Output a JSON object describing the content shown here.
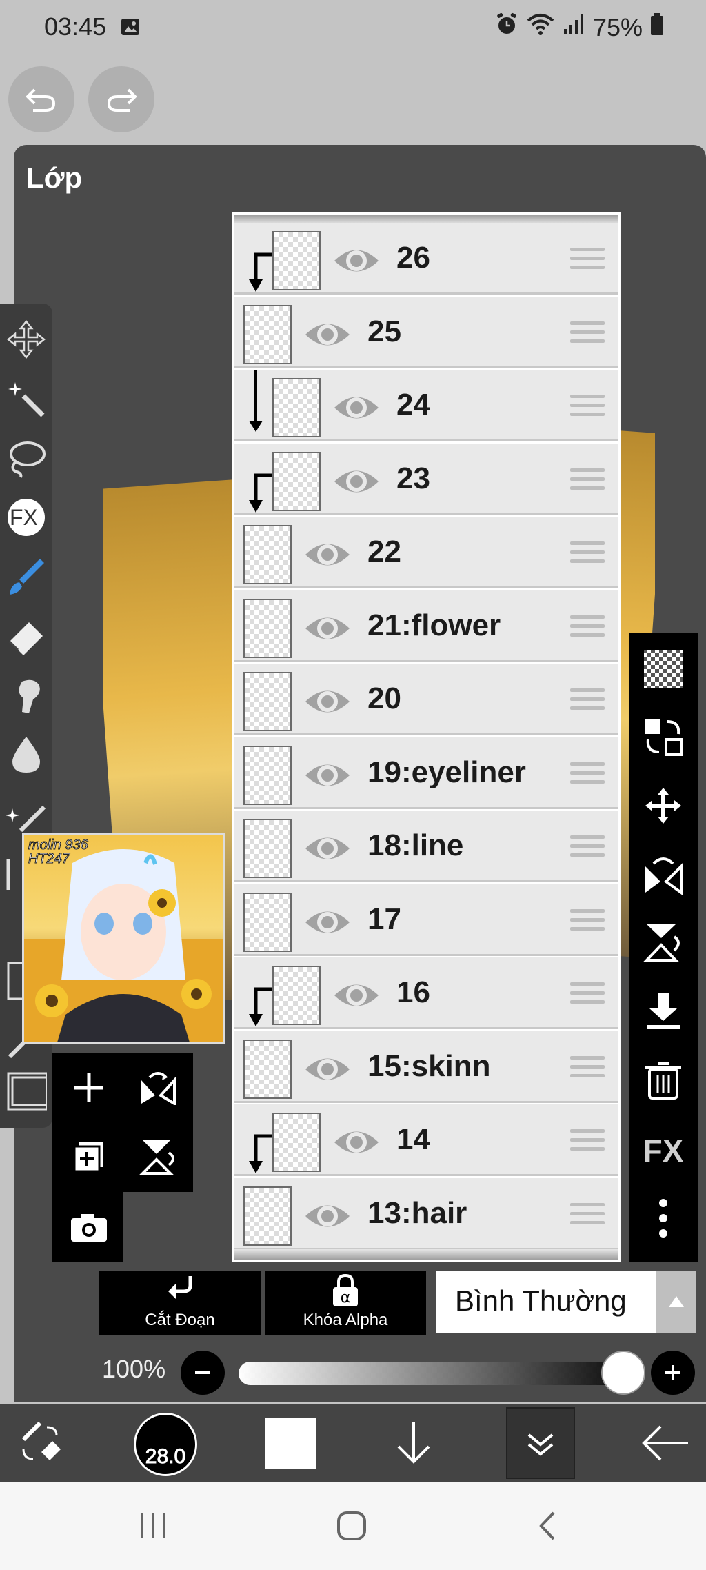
{
  "status_bar": {
    "time": "03:45",
    "battery": "75%",
    "icons": [
      "gallery-icon",
      "alarm-icon",
      "wifi-icon",
      "signal-icon",
      "battery-icon"
    ]
  },
  "panel": {
    "title": "Lớp"
  },
  "thumbnail_text": "molin 936\nHT247",
  "layers": [
    {
      "name": "26",
      "clipped": true
    },
    {
      "name": "25",
      "clipped": false
    },
    {
      "name": "24",
      "clipped": true
    },
    {
      "name": "23",
      "clipped": true
    },
    {
      "name": "22",
      "clipped": false
    },
    {
      "name": "21:flower",
      "clipped": false
    },
    {
      "name": "20",
      "clipped": false
    },
    {
      "name": "19:eyeliner",
      "clipped": false
    },
    {
      "name": "18:line",
      "clipped": false
    },
    {
      "name": "17",
      "clipped": false
    },
    {
      "name": "16",
      "clipped": true
    },
    {
      "name": "15:skinn",
      "clipped": false
    },
    {
      "name": "14",
      "clipped": true
    },
    {
      "name": "13:hair",
      "clipped": false
    }
  ],
  "controls": {
    "clipping_label": "Cắt Đoạn",
    "alpha_lock_label": "Khóa Alpha",
    "blend_mode": "Bình Thường",
    "opacity": "100%"
  },
  "right_tools": {
    "fx_label": "FX"
  },
  "left_tools": {
    "fx_label": "FX"
  },
  "bottom_bar": {
    "brush_size": "28.0"
  }
}
